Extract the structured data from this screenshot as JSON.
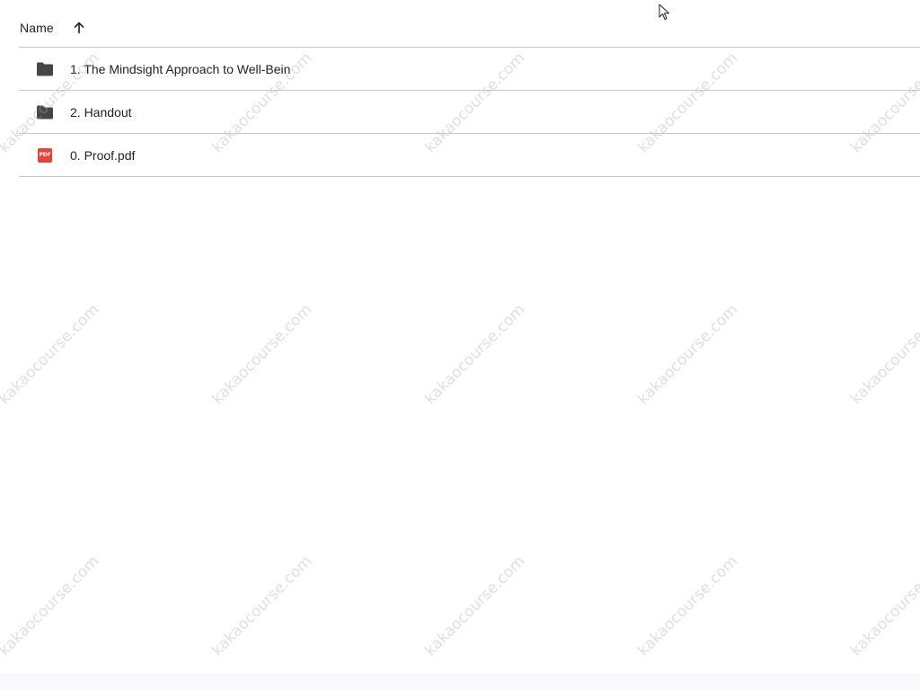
{
  "list": {
    "header": {
      "sort_label": "Name",
      "sort_icon": "arrow-up-icon"
    },
    "rows": [
      {
        "name": "1. The Mindsight Approach to Well-Bein",
        "type": "folder",
        "icon": "folder-icon"
      },
      {
        "name": "2. Handout",
        "type": "folder",
        "icon": "folder-icon"
      },
      {
        "name": "0. Proof.pdf",
        "type": "pdf",
        "icon": "pdf-icon",
        "badge_text": "PDF"
      }
    ]
  },
  "watermark": {
    "text": "kakaocourse.com",
    "color": "#aaaaaa"
  },
  "colors": {
    "divider": "#c7c7c7",
    "folder": "#444746",
    "pdf_red": "#ea4335"
  }
}
